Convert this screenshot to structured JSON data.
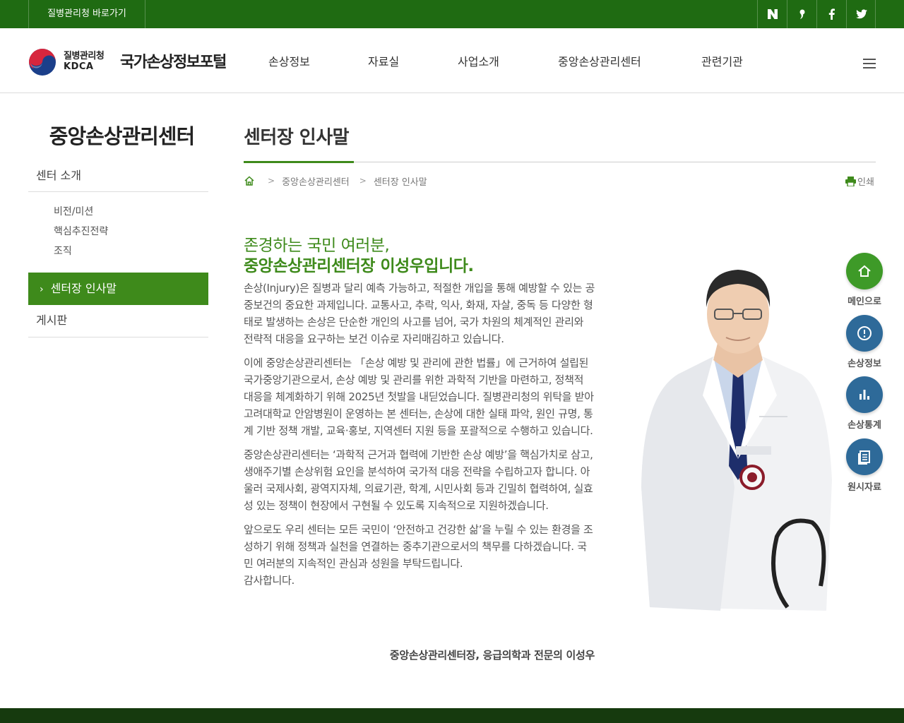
{
  "topbar": {
    "kdca_link": "질병관리청 바로가기",
    "sns": [
      "naver-blog-icon",
      "kakao-icon",
      "facebook-icon",
      "twitter-icon"
    ]
  },
  "header": {
    "logo_org": "질병관리청",
    "logo_org_en": "KDCA",
    "logo_portal": "국가손상정보포털",
    "gnb": [
      "손상정보",
      "자료실",
      "사업소개",
      "중앙손상관리센터",
      "관련기관"
    ]
  },
  "sidebar": {
    "title": "중앙손상관리센터",
    "section1": "센터 소개",
    "sub": [
      "비전/미션",
      "핵심추진전략",
      "조직"
    ],
    "active": "센터장 인사말",
    "section2": "게시판"
  },
  "content": {
    "page_title": "센터장 인사말",
    "breadcrumb": [
      "중앙손상관리센터",
      "센터장 인사말"
    ],
    "print": "인쇄",
    "greeting_line1": "존경하는 국민 여러분,",
    "greeting_line2": "중앙손상관리센터장 이성우입니다.",
    "paragraphs": [
      "손상(Injury)은 질병과 달리 예측 가능하고, 적절한 개입을 통해 예방할 수 있는 공중보건의 중요한 과제입니다. 교통사고, 추락, 익사, 화재, 자살, 중독 등 다양한 형태로 발생하는 손상은 단순한 개인의 사고를 넘어, 국가 차원의 체계적인 관리와 전략적 대응을 요구하는 보건 이슈로 자리매김하고 있습니다.",
      "이에 중앙손상관리센터는 「손상 예방 및 관리에 관한 법률」에 근거하여 설립된 국가중앙기관으로서, 손상 예방 및 관리를 위한 과학적 기반을 마련하고, 정책적 대응을 체계화하기 위해 2025년 첫발을 내딛었습니다. 질병관리청의 위탁을 받아 고려대학교 안암병원이 운영하는 본 센터는, 손상에 대한 실태 파악, 원인 규명, 통계 기반 정책 개발, 교육·홍보, 지역센터 지원 등을 포괄적으로 수행하고 있습니다.",
      "중앙손상관리센터는 ‘과학적 근거과 협력에 기반한 손상 예방’을 핵심가치로 삼고, 생애주기별 손상위험 요인을 분석하여 국가적 대응 전략을 수립하고자 합니다. 아울러 국제사회, 광역지자체, 의료기관, 학계, 시민사회 등과 긴밀히 협력하여, 실효성 있는 정책이 현장에서 구현될 수 있도록 지속적으로 지원하겠습니다.",
      "앞으로도 우리 센터는 모든 국민이 ‘안전하고 건강한 삶’을 누릴 수 있는 환경을 조성하기 위해 정책과 실천을 연결하는 중추기관으로서의 책무를 다하겠습니다. 국민 여러분의 지속적인 관심과 성원을 부탁드립니다."
    ],
    "thanks": "감사합니다.",
    "signature": "중앙손상관리센터장, 응급의학과 전문의 이성우"
  },
  "quick_menu": [
    {
      "label": "메인으로",
      "icon": "home-icon",
      "color": "#3e9a28"
    },
    {
      "label": "손상정보",
      "icon": "alert-icon",
      "color": "#2e6a99"
    },
    {
      "label": "손상통계",
      "icon": "bar-chart-icon",
      "color": "#2e6a99"
    },
    {
      "label": "원시자료",
      "icon": "document-icon",
      "color": "#2e6a99"
    }
  ]
}
